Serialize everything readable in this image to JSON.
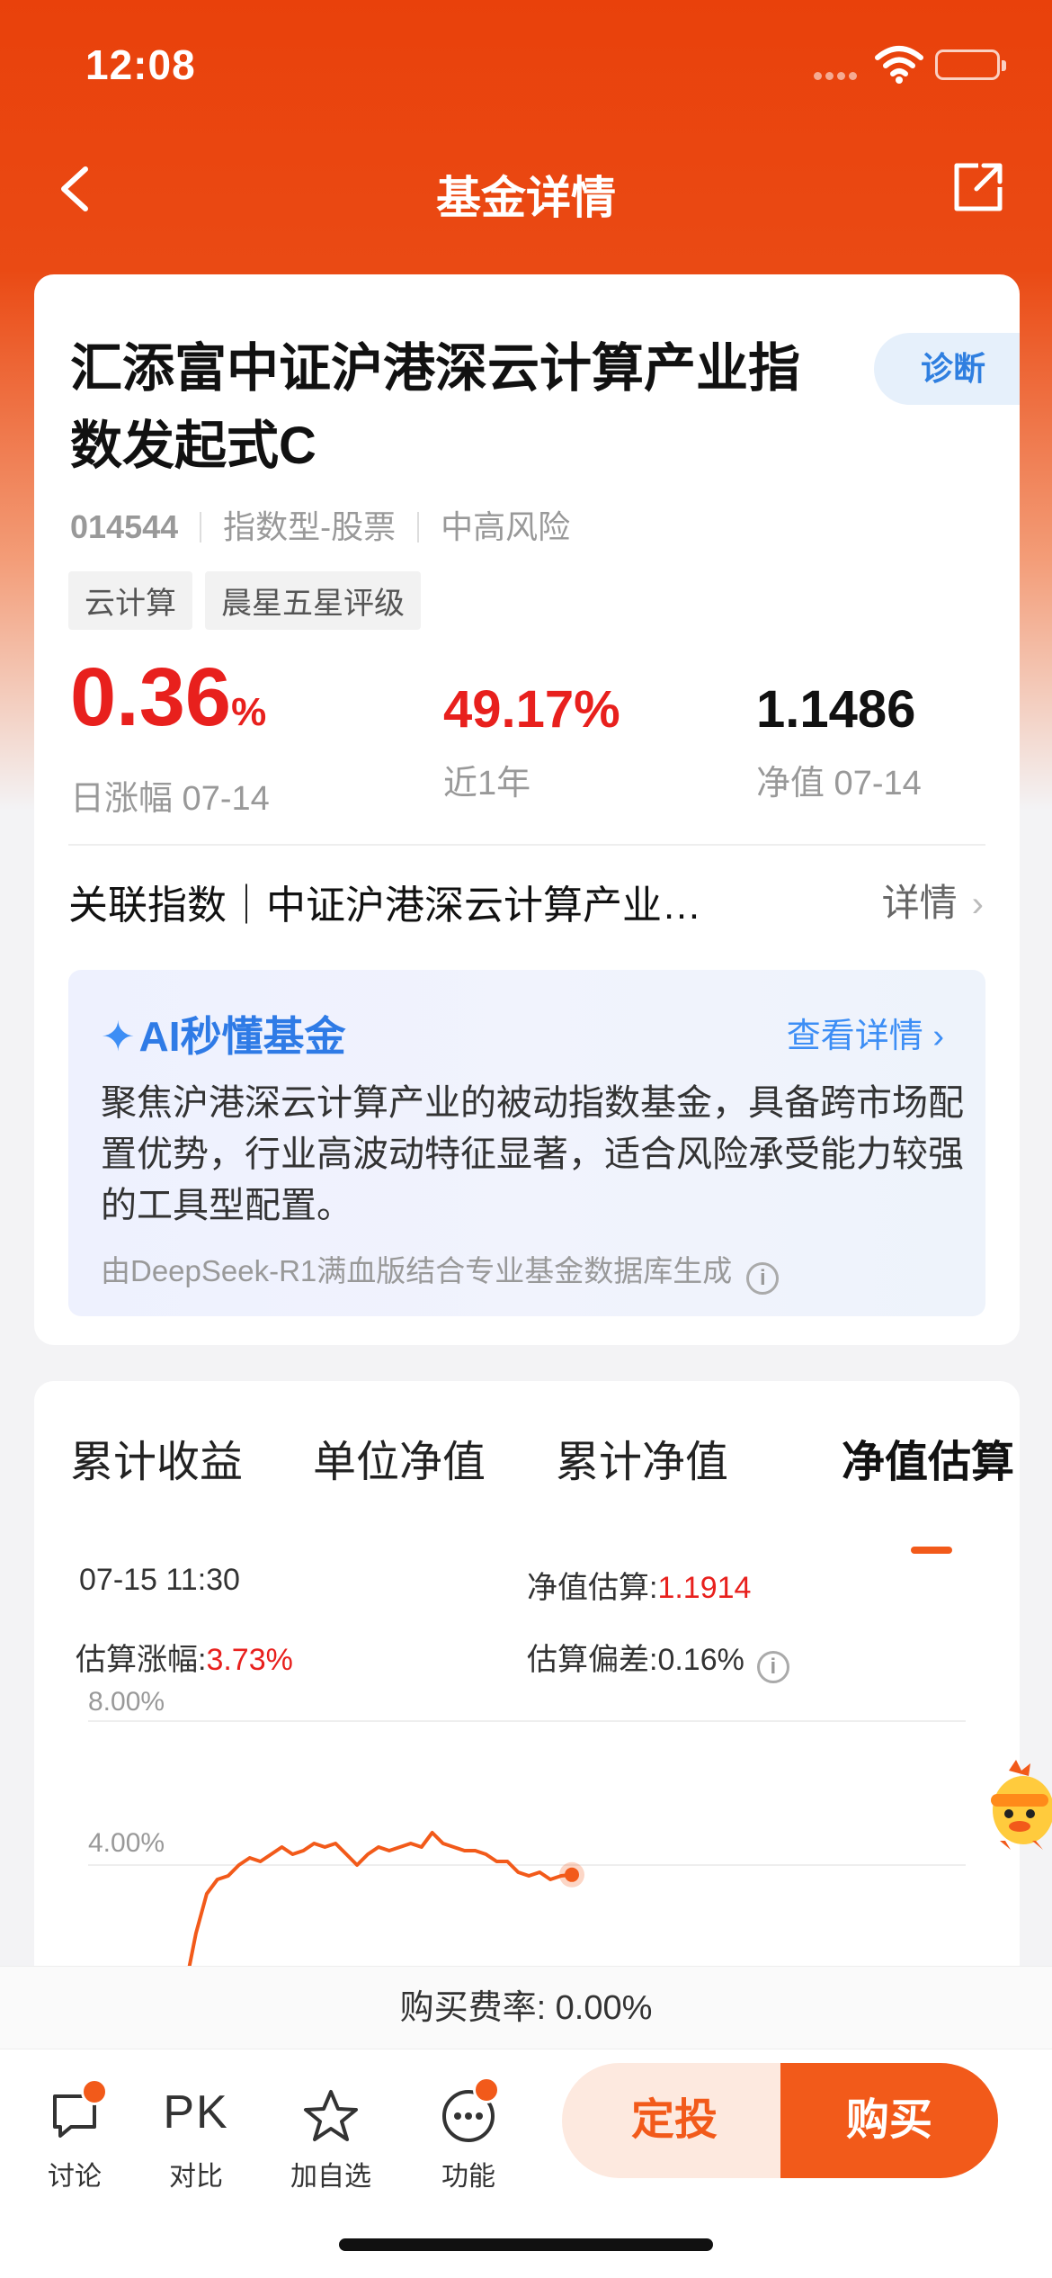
{
  "status_bar": {
    "time": "12:08"
  },
  "nav": {
    "title": "基金详情"
  },
  "fund": {
    "name": "汇添富中证沪港深云计算产业指数发起式C",
    "diagnose_label": "诊断",
    "code": "014544",
    "type": "指数型-股票",
    "risk": "中高风险",
    "tags": [
      "云计算",
      "晨星五星评级"
    ],
    "daily_change": {
      "value": "0.36",
      "unit": "%",
      "label": "日涨幅 07-14"
    },
    "year_return": {
      "value": "49.17%",
      "label": "近1年"
    },
    "nav": {
      "value": "1.1486",
      "label": "净值 07-14"
    }
  },
  "related_index": {
    "text": "关联指数｜中证沪港深云计算产业…",
    "detail": "详情"
  },
  "ai": {
    "title": "AI秒懂基金",
    "more": "查看详情",
    "text": "聚焦沪港深云计算产业的被动指数基金，具备跨市场配置优势，行业高波动特征显著，适合风险承受能力较强的工具型配置。",
    "footer": "由DeepSeek-R1满血版结合专业基金数据库生成"
  },
  "tabs": [
    "累计收益",
    "单位净值",
    "累计净值",
    "净值估算"
  ],
  "active_tab": "净值估算",
  "estimate": {
    "time": "07-15 11:30",
    "nav_label": "净值估算:",
    "nav_value": "1.1914",
    "change_label": "估算涨幅:",
    "change_value": "3.73%",
    "dev_label": "估算偏差:",
    "dev_value": "0.16%"
  },
  "chart_data": {
    "type": "line",
    "y_ticks": [
      "8.00%",
      "4.00%"
    ],
    "series": [
      {
        "values": [
          0.6,
          2.1,
          3.2,
          3.6,
          3.7,
          4.0,
          4.2,
          4.1,
          4.3,
          4.5,
          4.3,
          4.4,
          4.6,
          4.5,
          4.6,
          4.3,
          4.0,
          4.3,
          4.5,
          4.4,
          4.5,
          4.6,
          4.5,
          4.9,
          4.6,
          4.5,
          4.4,
          4.4,
          4.3,
          4.1,
          4.1,
          3.8,
          3.7,
          3.8,
          3.6,
          3.7,
          3.73
        ]
      }
    ]
  },
  "fee": {
    "text": "购买费率: 0.00%"
  },
  "bottom": {
    "discuss": "讨论",
    "pk_glyph": "PK",
    "compare": "对比",
    "favorite": "加自选",
    "functions": "功能",
    "auto_invest": "定投",
    "buy": "购买"
  },
  "colors": {
    "brand": "#e9410b",
    "accent": "#f25a1a",
    "up": "#e8201d",
    "ai_blue": "#2f7be6"
  }
}
